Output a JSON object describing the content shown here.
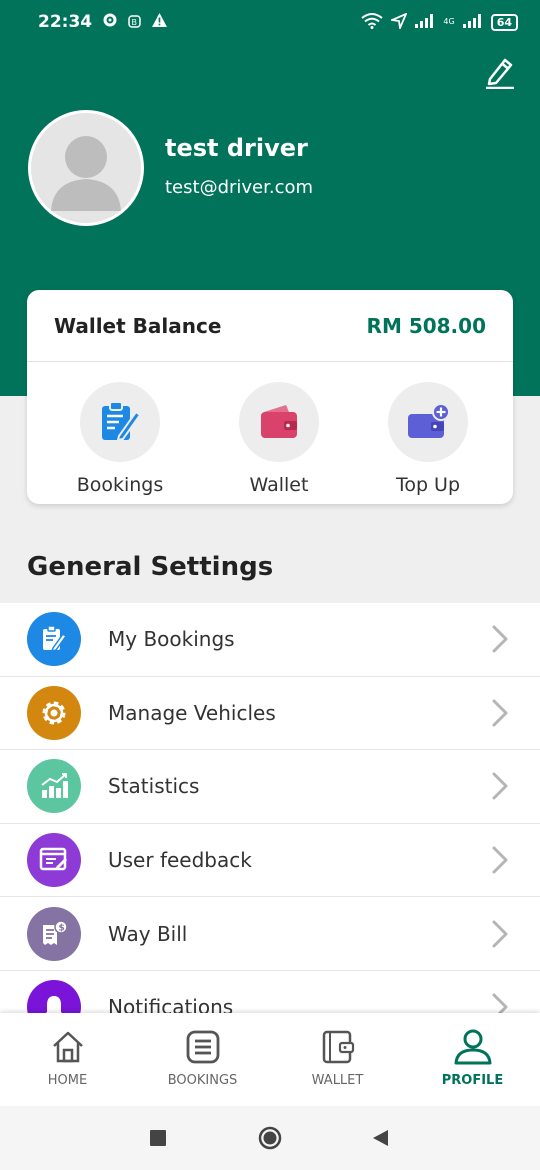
{
  "status_bar": {
    "time": "22:34",
    "network": "4G",
    "battery": "64"
  },
  "profile": {
    "name": "test driver",
    "email": "test@driver.com"
  },
  "wallet": {
    "label": "Wallet Balance",
    "amount": "RM 508.00"
  },
  "quick_actions": [
    {
      "label": "Bookings",
      "icon": "clipboard-edit-icon",
      "color": "#1e88e5"
    },
    {
      "label": "Wallet",
      "icon": "wallet-icon",
      "color": "#d9436b"
    },
    {
      "label": "Top Up",
      "icon": "wallet-add-icon",
      "color": "#5c5fd6"
    }
  ],
  "general_settings": {
    "title": "General Settings",
    "items": [
      {
        "label": "My Bookings",
        "icon": "clipboard-edit-icon",
        "color": "#1e88e5"
      },
      {
        "label": "Manage Vehicles",
        "icon": "gear-icon",
        "color": "#d4870f"
      },
      {
        "label": "Statistics",
        "icon": "bar-chart-icon",
        "color": "#5cc6a1"
      },
      {
        "label": "User feedback",
        "icon": "feedback-icon",
        "color": "#8e3ad6"
      },
      {
        "label": "Way Bill",
        "icon": "bill-icon",
        "color": "#8573a3"
      },
      {
        "label": "Notifications",
        "icon": "bell-icon",
        "color": "#7a14d9"
      }
    ]
  },
  "bottom_nav": {
    "items": [
      {
        "label": "HOME",
        "icon": "home-icon"
      },
      {
        "label": "BOOKINGS",
        "icon": "list-icon"
      },
      {
        "label": "WALLET",
        "icon": "wallet-outline-icon"
      },
      {
        "label": "PROFILE",
        "icon": "person-icon"
      }
    ],
    "active": "PROFILE"
  },
  "colors": {
    "primary": "#00735a",
    "background": "#efefef"
  }
}
